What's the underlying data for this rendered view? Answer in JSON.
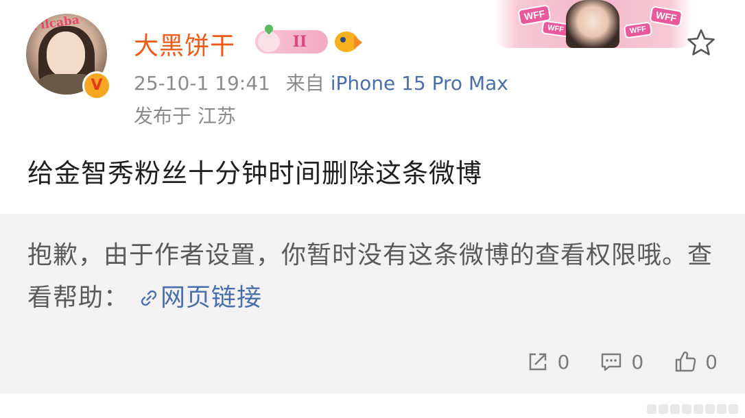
{
  "author": {
    "name": "大黑饼干",
    "avatar_caption": "Pilcaba",
    "verified_mark": "V",
    "level_badge": "II"
  },
  "banner": {
    "tags": [
      "WFF",
      "WFF",
      "WFF",
      "WFF"
    ]
  },
  "meta": {
    "time": "25-10-1 19:41",
    "source_prefix": "来自",
    "device": "iPhone 15 Pro Max",
    "location": "发布于 江苏"
  },
  "post": {
    "text": "给金智秀粉丝十分钟时间删除这条微博"
  },
  "repost": {
    "notice": "抱歉，由于作者设置，你暂时没有这条微博的查看权限哦。查看帮助：",
    "link_label": "网页链接"
  },
  "actions": {
    "repost_count": "0",
    "comment_count": "0",
    "like_count": "0"
  },
  "colors": {
    "username": "#f05a14",
    "link": "#4a6fa8",
    "panel_bg": "#f2f2f2",
    "meta_gray": "#8b8b8b"
  },
  "icons": [
    "star-icon",
    "link-icon",
    "repost-icon",
    "comment-icon",
    "like-icon"
  ]
}
